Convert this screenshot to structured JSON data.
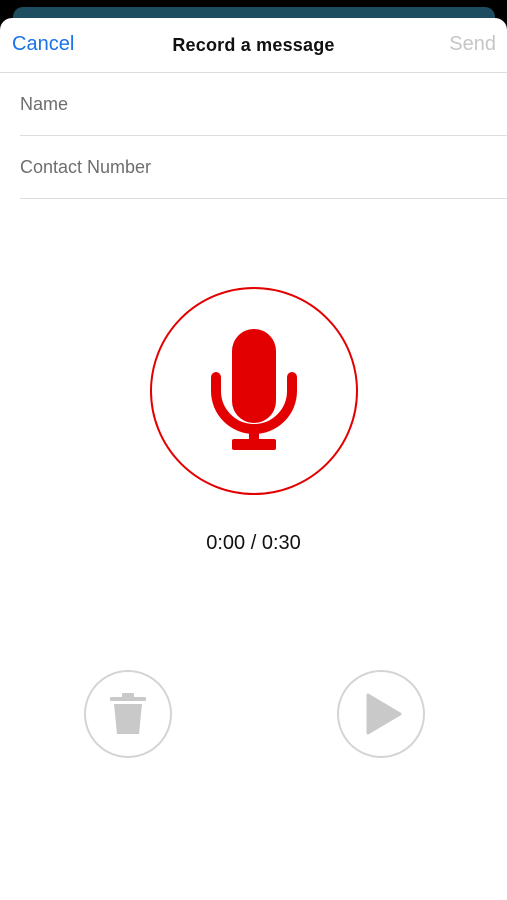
{
  "header": {
    "cancel_label": "Cancel",
    "title": "Record a message",
    "send_label": "Send"
  },
  "form": {
    "name": {
      "value": "",
      "placeholder": "Name"
    },
    "contact": {
      "value": "",
      "placeholder": "Contact Number"
    }
  },
  "recorder": {
    "elapsed": "0:00",
    "limit": "0:30",
    "timer_text": "0:00 / 0:30",
    "record_icon": "microphone-icon",
    "delete_icon": "trash-icon",
    "play_icon": "play-icon"
  },
  "colors": {
    "accent_blue": "#1a73e8",
    "record_red": "#e30000",
    "disabled_gray": "#c6c6c6",
    "backdrop_card": "#1d4e5f"
  }
}
